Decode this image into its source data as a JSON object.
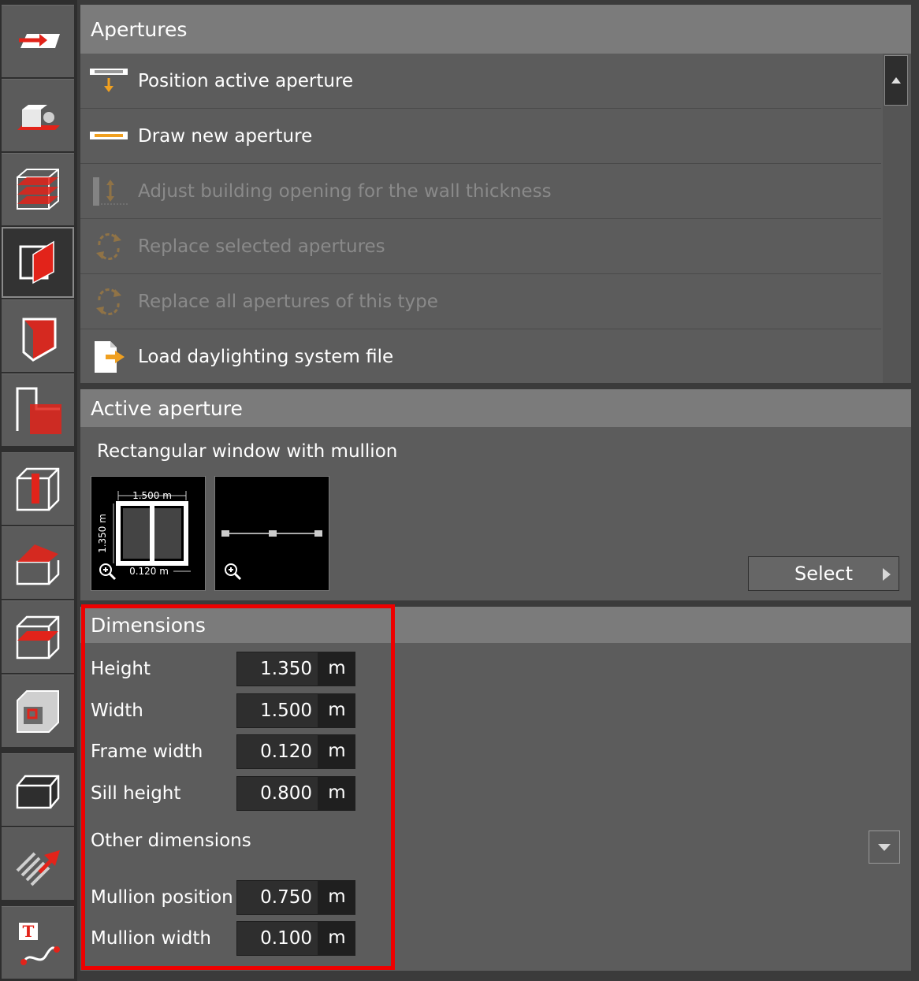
{
  "toolbar": {
    "tools": [
      {
        "name": "import-tool-icon"
      },
      {
        "name": "object-tool-icon"
      },
      {
        "name": "floors-tool-icon"
      },
      {
        "name": "apertures-tool-icon",
        "active": true
      },
      {
        "name": "surface-tool-icon"
      },
      {
        "name": "room-layout-tool-icon"
      },
      {
        "name": "column-tool-icon"
      },
      {
        "name": "roof-tool-icon"
      },
      {
        "name": "slab-tool-icon"
      },
      {
        "name": "interior-tool-icon"
      },
      {
        "name": "box-tool-icon"
      },
      {
        "name": "hatch-tool-icon"
      },
      {
        "name": "text-curve-tool-icon"
      }
    ]
  },
  "apertures": {
    "title": "Apertures",
    "items": [
      {
        "label": "Position active aperture",
        "enabled": true,
        "icon": "position-aperture-icon"
      },
      {
        "label": "Draw new aperture",
        "enabled": true,
        "icon": "draw-aperture-icon"
      },
      {
        "label": "Adjust building opening for the wall thickness",
        "enabled": false,
        "icon": "adjust-opening-icon"
      },
      {
        "label": "Replace selected apertures",
        "enabled": false,
        "icon": "replace-selected-icon"
      },
      {
        "label": "Replace all apertures of this type",
        "enabled": false,
        "icon": "replace-all-icon"
      },
      {
        "label": "Load daylighting system file",
        "enabled": true,
        "icon": "load-file-icon"
      }
    ]
  },
  "active_aperture": {
    "title": "Active aperture",
    "name": "Rectangular window with mullion",
    "preview": {
      "width_label": "1.500 m",
      "height_label": "1.350 m",
      "frame_label": "0.120 m"
    },
    "select_label": "Select"
  },
  "dimensions": {
    "title": "Dimensions",
    "rows": [
      {
        "label": "Height",
        "value": "1.350",
        "unit": "m"
      },
      {
        "label": "Width",
        "value": "1.500",
        "unit": "m"
      },
      {
        "label": "Frame width",
        "value": "0.120",
        "unit": "m"
      },
      {
        "label": "Sill height",
        "value": "0.800",
        "unit": "m"
      }
    ],
    "other_title": "Other dimensions",
    "other_rows": [
      {
        "label": "Mullion position",
        "value": "0.750",
        "unit": "m"
      },
      {
        "label": "Mullion width",
        "value": "0.100",
        "unit": "m"
      }
    ]
  },
  "colors": {
    "accent": "#e2231a",
    "highlight": "#ee0000",
    "header": "#7b7b7b",
    "panel": "#5c5c5c",
    "arrow_orange": "#f0a020"
  }
}
